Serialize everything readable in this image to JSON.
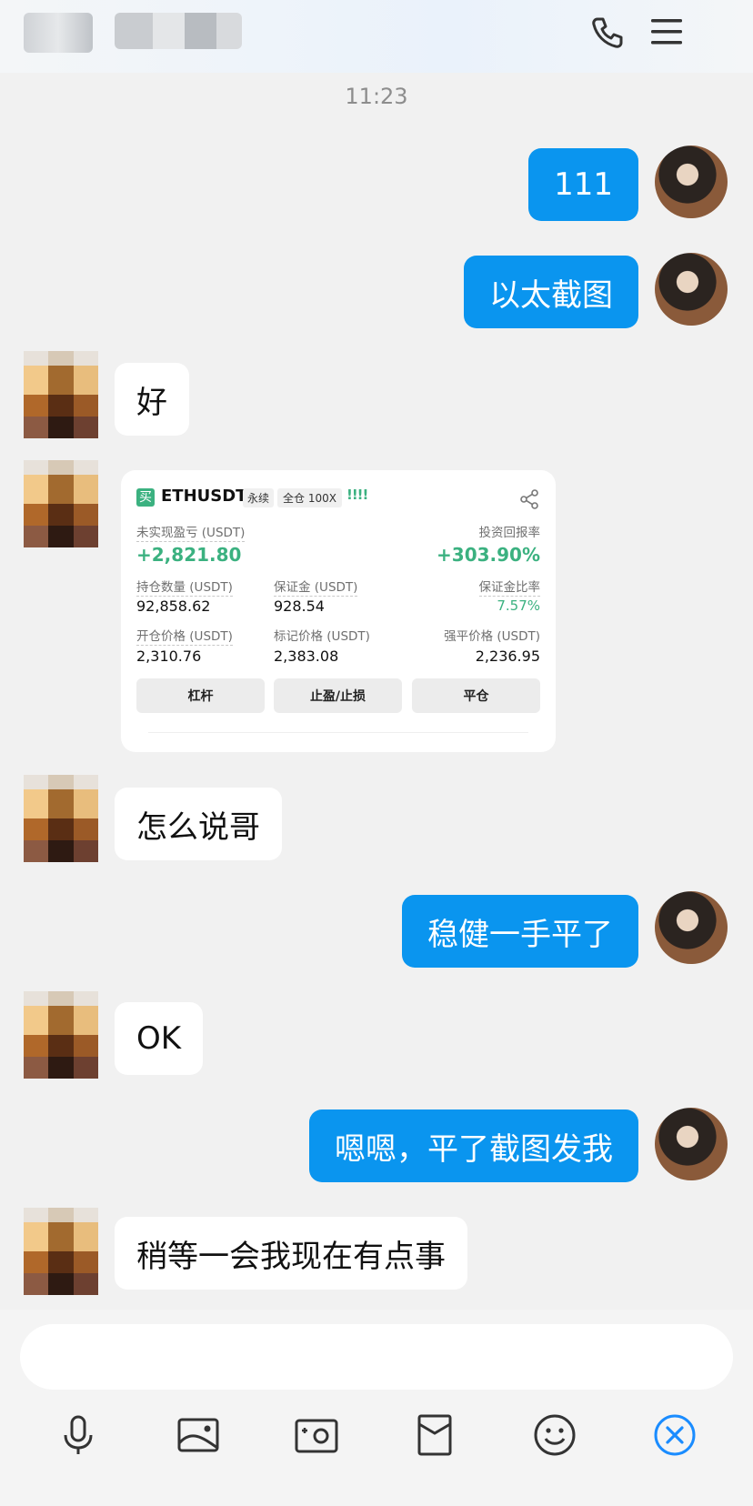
{
  "header": {
    "call_icon": "phone-icon",
    "menu_icon": "menu-icon"
  },
  "time": "11:23",
  "messages": [
    {
      "side": "me",
      "text": "111"
    },
    {
      "side": "me",
      "text": "以太截图"
    },
    {
      "side": "other",
      "text": "好"
    },
    {
      "side": "other",
      "type": "card"
    },
    {
      "side": "other",
      "text": "怎么说哥"
    },
    {
      "side": "me",
      "text": "稳健一手平了"
    },
    {
      "side": "other",
      "text": "OK"
    },
    {
      "side": "me",
      "text": "嗯嗯，平了截图发我"
    },
    {
      "side": "other",
      "text": "稍等一会我现在有点事"
    }
  ],
  "card": {
    "buy_badge": "买",
    "symbol": "ETHUSDT",
    "tag_perpetual": "永续",
    "tag_margin": "全仓 100X",
    "signal_bars": "!!!!",
    "unrealized_label": "未实现盈亏 (USDT)",
    "unrealized_value": "+2,821.80",
    "roi_label": "投资回报率",
    "roi_value": "+303.90%",
    "position_label": "持仓数量 (USDT)",
    "position_value": "92,858.62",
    "margin_label": "保证金 (USDT)",
    "margin_value": "928.54",
    "margin_ratio_label": "保证金比率",
    "margin_ratio_value": "7.57%",
    "entry_label": "开仓价格 (USDT)",
    "entry_value": "2,310.76",
    "mark_label": "标记价格 (USDT)",
    "mark_value": "2,383.08",
    "liq_label": "强平价格 (USDT)",
    "liq_value": "2,236.95",
    "btn_leverage": "杠杆",
    "btn_tpsl": "止盈/止损",
    "btn_close": "平仓",
    "green_color": "#3bb180",
    "share_icon": "share-icon"
  },
  "toolbar": {
    "icons": [
      "microphone-icon",
      "image-icon",
      "camera-icon",
      "red-envelope-icon",
      "emoji-icon",
      "close-circle-icon"
    ]
  },
  "colors": {
    "me_bubble": "#0a95ef",
    "accent": "#1a8cff"
  }
}
